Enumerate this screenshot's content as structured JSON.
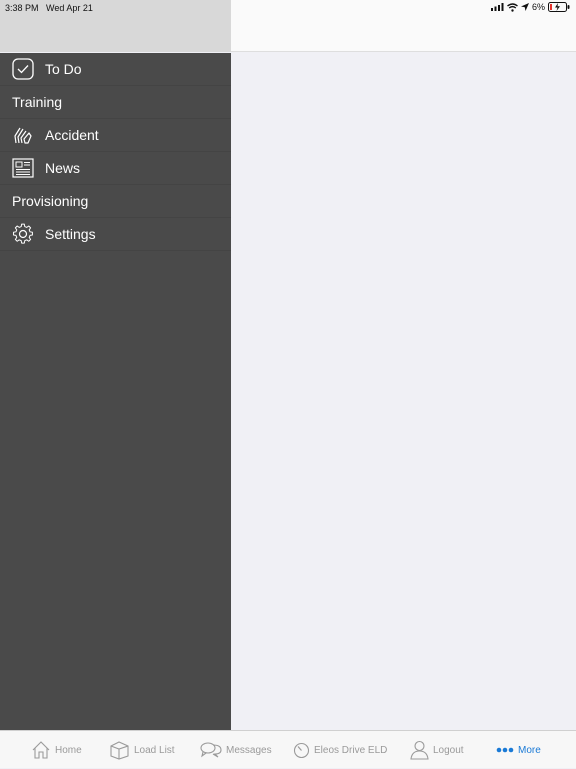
{
  "status": {
    "time": "3:38 PM",
    "date": "Wed Apr 21",
    "battery": "6%"
  },
  "sidebar": {
    "items": [
      {
        "label": "To Do",
        "icon": "checkmark-icon"
      },
      {
        "label": "Training"
      },
      {
        "label": "Accident",
        "icon": "hands-icon"
      },
      {
        "label": "News",
        "icon": "newspaper-icon"
      },
      {
        "label": "Provisioning"
      },
      {
        "label": "Settings",
        "icon": "gear-icon"
      }
    ]
  },
  "tabbar": {
    "tabs": [
      {
        "label": "Home",
        "icon": "home-icon"
      },
      {
        "label": "Load List",
        "icon": "box-icon"
      },
      {
        "label": "Messages",
        "icon": "chat-icon"
      },
      {
        "label": "Eleos Drive ELD",
        "icon": "gauge-icon"
      },
      {
        "label": "Logout",
        "icon": "person-icon"
      },
      {
        "label": "More",
        "icon": "more-dots-icon"
      }
    ],
    "active_color": "#1a7ad6",
    "inactive_color": "#9a9a9a"
  },
  "colors": {
    "sidebar_bg": "#4a4a4a",
    "main_bg": "#f0f0f5"
  }
}
